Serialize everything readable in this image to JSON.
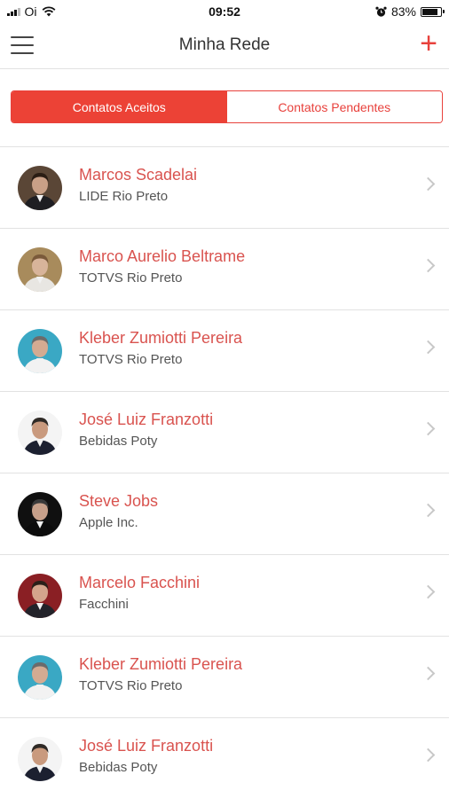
{
  "status_bar": {
    "carrier": "Oi",
    "time": "09:52",
    "battery": "83%",
    "battery_level": 0.83,
    "icons": [
      "signal-icon",
      "wifi-icon",
      "alarm-icon",
      "battery-icon"
    ]
  },
  "nav": {
    "title": "Minha Rede",
    "menu_icon": "hamburger-menu-icon",
    "add_icon": "plus-icon",
    "add_label": "+"
  },
  "tabs": [
    {
      "label": "Contatos Aceitos",
      "active": true
    },
    {
      "label": "Contatos Pendentes",
      "active": false
    }
  ],
  "colors": {
    "accent": "#e8413c",
    "name_text": "#d9534f"
  },
  "contacts": [
    {
      "name": "Marcos Scadelai",
      "company": "LIDE Rio Preto",
      "avatar": {
        "bg": "#5a4636",
        "skin": "#c9a087",
        "hair": "#2a1d14",
        "suit": "#1e1e22"
      }
    },
    {
      "name": "Marco Aurelio Beltrame",
      "company": "TOTVS Rio Preto",
      "avatar": {
        "bg": "#a88b5c",
        "skin": "#d8b49a",
        "hair": "#7a5a3a",
        "suit": "#e8e6e2"
      }
    },
    {
      "name": "Kleber Zumiotti Pereira",
      "company": "TOTVS Rio Preto",
      "avatar": {
        "bg": "#3aa8c4",
        "skin": "#d4ab92",
        "hair": "#6b6b6b",
        "suit": "#f2f2f2"
      }
    },
    {
      "name": "José Luiz Franzotti",
      "company": "Bebidas Poty",
      "avatar": {
        "bg": "#f4f4f4",
        "skin": "#c99a7e",
        "hair": "#2f2a26",
        "suit": "#1c2030"
      }
    },
    {
      "name": "Steve Jobs",
      "company": "Apple Inc.",
      "avatar": {
        "bg": "#101010",
        "skin": "#c7a08a",
        "hair": "#3a3a3a",
        "suit": "#0c0c0c"
      }
    },
    {
      "name": "Marcelo Facchini",
      "company": "Facchini",
      "avatar": {
        "bg": "#8a1f24",
        "skin": "#d4a48c",
        "hair": "#2a1e18",
        "suit": "#23232a"
      }
    },
    {
      "name": "Kleber Zumiotti Pereira",
      "company": "TOTVS Rio Preto",
      "avatar": {
        "bg": "#3aa8c4",
        "skin": "#d4ab92",
        "hair": "#6b6b6b",
        "suit": "#f2f2f2"
      }
    },
    {
      "name": "José Luiz Franzotti",
      "company": "Bebidas Poty",
      "avatar": {
        "bg": "#f4f4f4",
        "skin": "#c99a7e",
        "hair": "#2f2a26",
        "suit": "#1c2030"
      }
    }
  ]
}
